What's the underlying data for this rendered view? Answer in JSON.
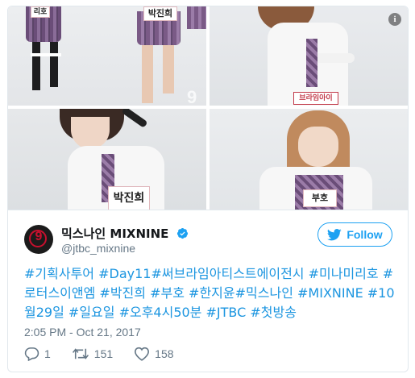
{
  "media": {
    "info_icon": "info-icon",
    "watermark": "9",
    "name_tags": {
      "photo1_left": "리호",
      "photo1_mid": "박진희",
      "photo2": "브라임아이",
      "photo3": "박진희",
      "photo4": "부호"
    }
  },
  "account": {
    "display_name": "믹스나인 MIXNINE",
    "handle": "@jtbc_mixnine",
    "avatar_text": "9",
    "verified_icon": "verified-badge-icon"
  },
  "follow": {
    "label": "Follow",
    "icon": "twitter-bird-icon",
    "color": "#1da1f2"
  },
  "tweet": {
    "segments": [
      {
        "text": "#기획사투어",
        "hashtag": true
      },
      {
        "text": " ",
        "hashtag": false
      },
      {
        "text": "#Day11",
        "hashtag": true
      },
      {
        "text": "#써브라임아티스트에이전시",
        "hashtag": true
      },
      {
        "text": " ",
        "hashtag": false
      },
      {
        "text": "#미나미리호",
        "hashtag": true
      },
      {
        "text": " ",
        "hashtag": false
      },
      {
        "text": "#로터스이앤엠",
        "hashtag": true
      },
      {
        "text": " ",
        "hashtag": false
      },
      {
        "text": "#박진희",
        "hashtag": true
      },
      {
        "text": " ",
        "hashtag": false
      },
      {
        "text": "#부호",
        "hashtag": true
      },
      {
        "text": " ",
        "hashtag": false
      },
      {
        "text": "#한지윤",
        "hashtag": true
      },
      {
        "text": "#믹스나인",
        "hashtag": true
      },
      {
        "text": " ",
        "hashtag": false
      },
      {
        "text": "#MIXNINE",
        "hashtag": true
      },
      {
        "text": " ",
        "hashtag": false
      },
      {
        "text": "#10월29일",
        "hashtag": true
      },
      {
        "text": " ",
        "hashtag": false
      },
      {
        "text": "#일요일",
        "hashtag": true
      },
      {
        "text": " ",
        "hashtag": false
      },
      {
        "text": "#오후4시50분",
        "hashtag": true
      },
      {
        "text": " ",
        "hashtag": false
      },
      {
        "text": "#JTBC",
        "hashtag": true
      },
      {
        "text": " ",
        "hashtag": false
      },
      {
        "text": "#첫방송",
        "hashtag": true
      }
    ],
    "timestamp": "2:05 PM - Oct 21, 2017"
  },
  "actions": {
    "reply": {
      "icon": "reply-icon",
      "count": "1"
    },
    "retweet": {
      "icon": "retweet-icon",
      "count": "151"
    },
    "like": {
      "icon": "heart-icon",
      "count": "158"
    }
  },
  "colors": {
    "link": "#1b95e0",
    "secondary_text": "#657786",
    "border": "#e1e8ed"
  }
}
